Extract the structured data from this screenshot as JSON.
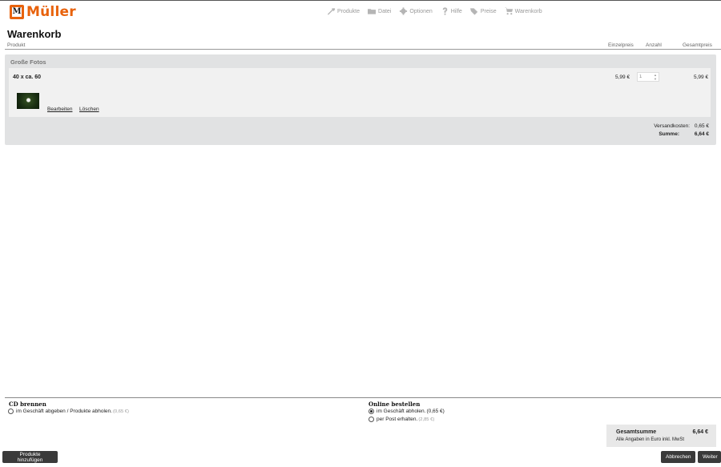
{
  "brand": {
    "name": "Müller",
    "mark": "M",
    "color": "#e8620c"
  },
  "nav": [
    {
      "label": "Produkte",
      "icon": "tools-icon"
    },
    {
      "label": "Datei",
      "icon": "folder-icon"
    },
    {
      "label": "Optionen",
      "icon": "gear-icon"
    },
    {
      "label": "Hilfe",
      "icon": "question-icon"
    },
    {
      "label": "Preise",
      "icon": "price-tags-icon"
    },
    {
      "label": "Warenkorb",
      "icon": "cart-icon"
    }
  ],
  "page": {
    "title": "Warenkorb",
    "columns": {
      "product": "Produkt",
      "unit": "Einzelpreis",
      "qty": "Anzahl",
      "total": "Gesamtpreis"
    }
  },
  "cart": {
    "group_title": "Große Fotos",
    "items": [
      {
        "name": "40 x ca. 60",
        "unit_price": "5,99 €",
        "quantity": "1",
        "total_price": "5,99 €",
        "edit_label": "Bearbeiten",
        "delete_label": "Löschen"
      }
    ],
    "shipping_label": "Versandkosten:",
    "shipping_value": "0,65 €",
    "sum_label": "Summe:",
    "sum_value": "6,64 €"
  },
  "options": {
    "cd": {
      "title": "CD brennen",
      "choices": [
        {
          "label": "im Geschäft abgeben / Produkte abholen.",
          "price": "(0,65 €)",
          "checked": false
        }
      ]
    },
    "order": {
      "title": "Online bestellen",
      "choices": [
        {
          "label": "im Geschäft abholen.",
          "price": "(0,65 €)",
          "checked": true
        },
        {
          "label": "per Post erhalten.",
          "price": "(2,85 €)",
          "checked": false
        }
      ]
    }
  },
  "summary": {
    "label": "Gesamtsumme",
    "value": "6,64 €",
    "note": "Alle Angaben in Euro inkl. MwSt"
  },
  "buttons": {
    "add": "Produkte hinzufügen",
    "cancel": "Abbrechen",
    "next": "Weiter"
  }
}
